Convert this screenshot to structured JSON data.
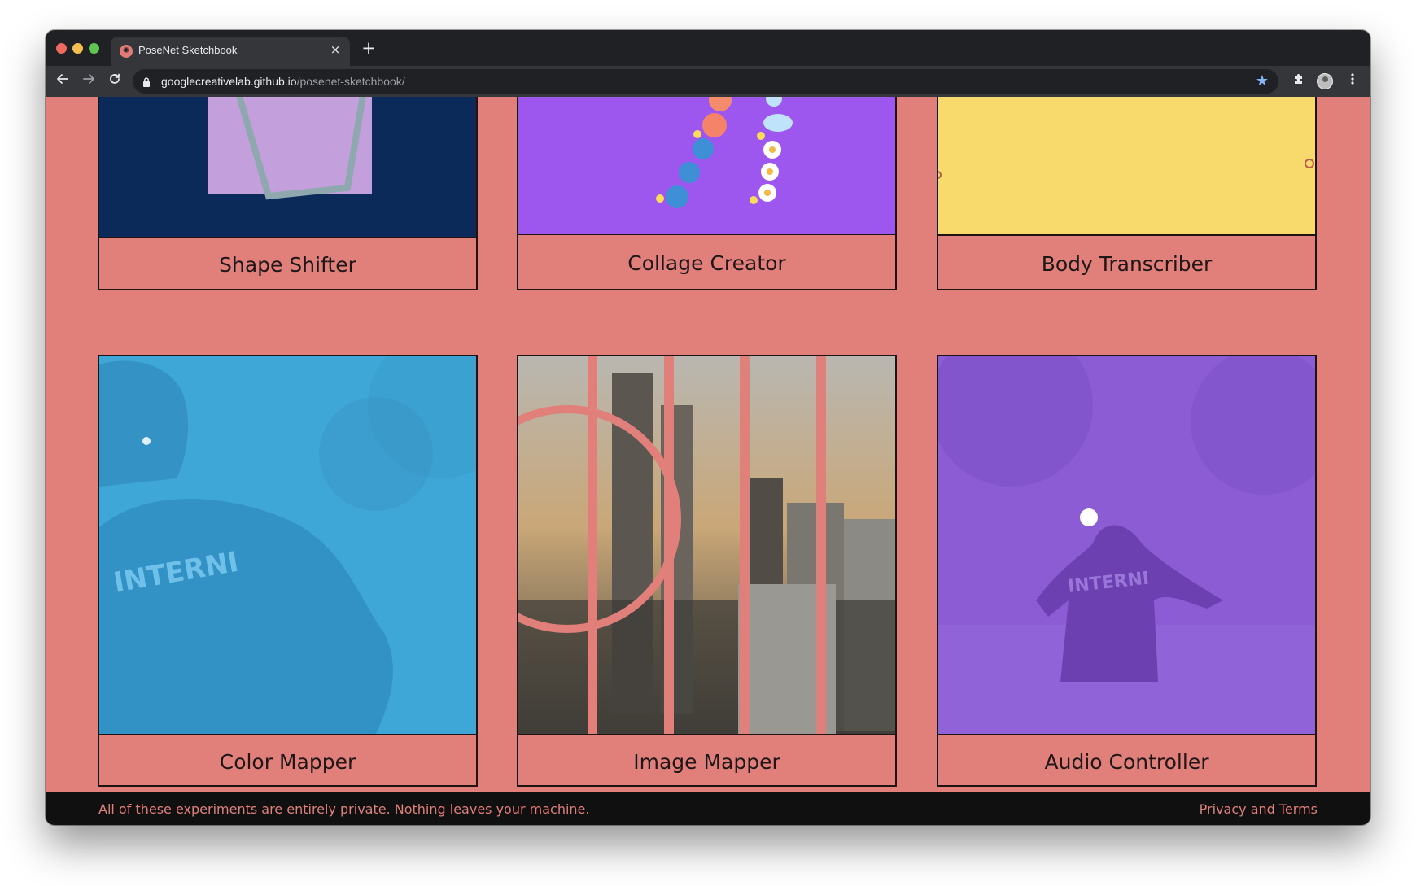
{
  "browser": {
    "tab": {
      "title": "PoseNet Sketchbook",
      "favicon": "posenet-favicon"
    },
    "new_tab_symbol": "+",
    "close_symbol": "×",
    "url": {
      "host": "googlecreativelab.github.io",
      "path": "/posenet-sketchbook/"
    },
    "icons": [
      "back-arrow-icon",
      "forward-arrow-icon",
      "reload-icon",
      "lock-icon",
      "star-icon",
      "extensions-icon",
      "profile-avatar",
      "more-menu-icon"
    ]
  },
  "experiments": [
    {
      "label": "Shape Shifter",
      "bg": "#0b2a5a"
    },
    {
      "label": "Collage Creator",
      "bg": "#9e57ee"
    },
    {
      "label": "Body Transcriber",
      "bg": "#f8da6c"
    },
    {
      "label": "Color Mapper",
      "bg": "#3aa3d4"
    },
    {
      "label": "Image Mapper",
      "bg": "#6b6f78"
    },
    {
      "label": "Audio Controller",
      "bg": "#8a5ad2"
    }
  ],
  "footer": {
    "privacy_note": "All of these experiments are entirely private. Nothing leaves your machine.",
    "link": "Privacy and Terms"
  },
  "colors": {
    "page_bg": "#e17f7b",
    "border": "#1e1414",
    "footer_bg": "#101010",
    "accent": "#e17f7b"
  }
}
